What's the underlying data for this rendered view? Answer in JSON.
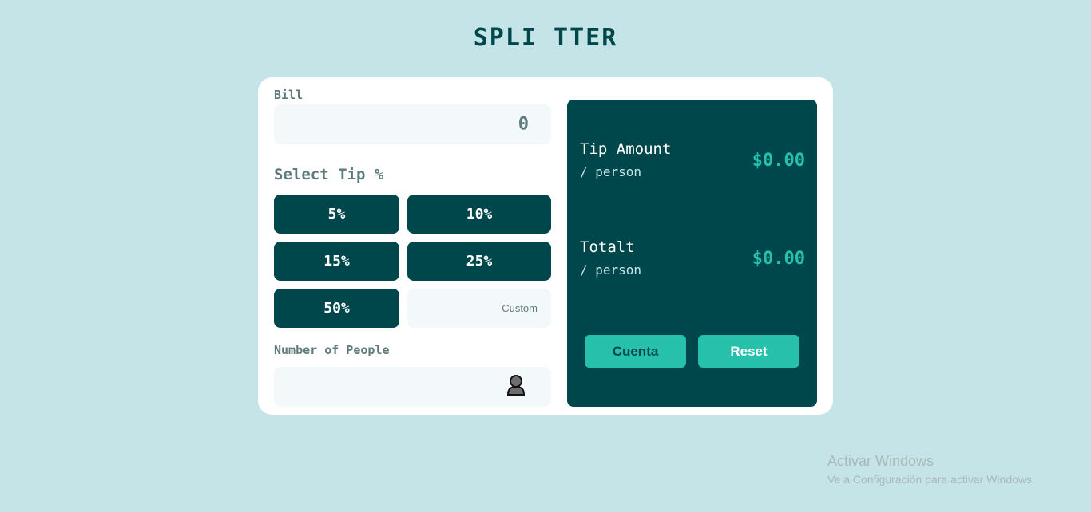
{
  "app": {
    "title": "SPLI TTER"
  },
  "bill": {
    "label": "Bill",
    "value": "0"
  },
  "tip": {
    "label": "Select Tip %",
    "options": [
      "5%",
      "10%",
      "15%",
      "25%",
      "50%"
    ],
    "custom_placeholder": "Custom"
  },
  "people": {
    "label": "Number of People",
    "icon": "person-icon"
  },
  "results": {
    "tip_amount": {
      "title": "Tip Amount",
      "sub": "/ person",
      "value": "$0.00"
    },
    "total": {
      "title": "Totalt",
      "sub": "/ person",
      "value": "$0.00"
    }
  },
  "actions": {
    "cuenta_label": "Cuenta",
    "reset_label": "Reset"
  },
  "watermark": {
    "line1": "Activar Windows",
    "line2": "Ve a Configuración para activar Windows."
  },
  "colors": {
    "background": "#c5e4e7",
    "dark_cyan": "#00474b",
    "accent": "#26c0ab",
    "input_bg": "#f3f9fa"
  }
}
